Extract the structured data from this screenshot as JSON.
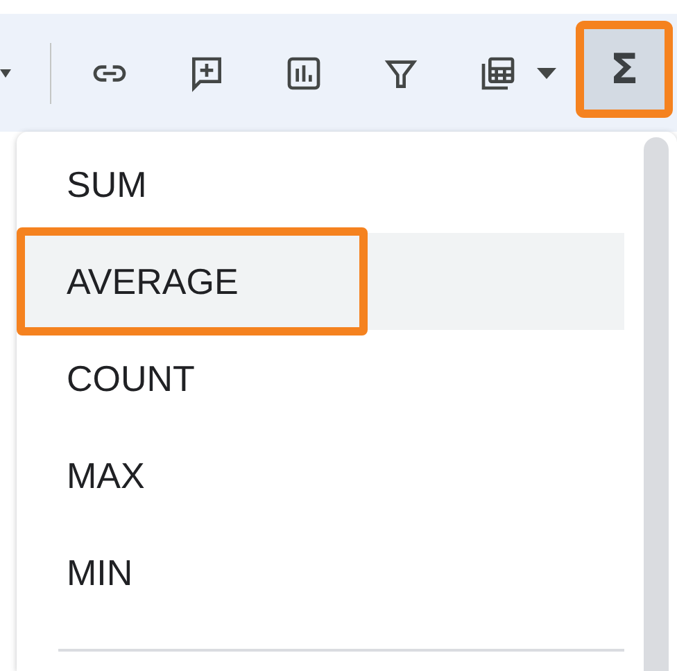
{
  "toolbar": {
    "sum_button": {
      "label": "Σ",
      "pressed": true,
      "annotated": true
    }
  },
  "menu": {
    "items": [
      {
        "label": "SUM",
        "selected": false,
        "annotated": false
      },
      {
        "label": "AVERAGE",
        "selected": true,
        "annotated": true
      },
      {
        "label": "COUNT",
        "selected": false,
        "annotated": false
      },
      {
        "label": "MAX",
        "selected": false,
        "annotated": false
      },
      {
        "label": "MIN",
        "selected": false,
        "annotated": false
      }
    ]
  }
}
